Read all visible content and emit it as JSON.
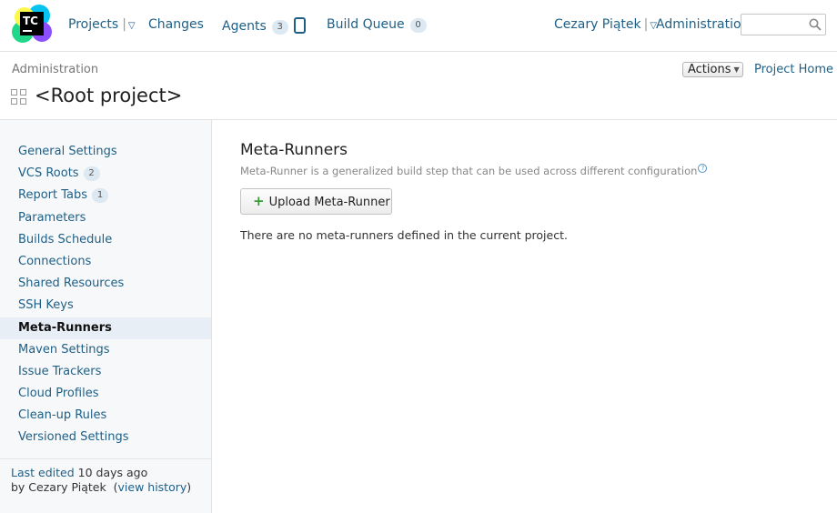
{
  "header": {
    "logo_text": "TC",
    "nav": {
      "projects": "Projects",
      "changes": "Changes",
      "agents": "Agents",
      "agents_count": "3",
      "build_queue": "Build Queue",
      "build_queue_count": "0",
      "user": "Cezary Piątek",
      "administration": "Administration"
    },
    "search": {
      "value": "",
      "placeholder": ""
    }
  },
  "page": {
    "breadcrumb": "Administration",
    "title": "<Root project>",
    "actions_label": "Actions",
    "project_home": "Project Home"
  },
  "sidebar": {
    "items": [
      {
        "label": "General Settings",
        "count": ""
      },
      {
        "label": "VCS Roots",
        "count": "2"
      },
      {
        "label": "Report Tabs",
        "count": "1"
      },
      {
        "label": "Parameters",
        "count": ""
      },
      {
        "label": "Builds Schedule",
        "count": ""
      },
      {
        "label": "Connections",
        "count": ""
      },
      {
        "label": "Shared Resources",
        "count": ""
      },
      {
        "label": "SSH Keys",
        "count": ""
      },
      {
        "label": "Meta-Runners",
        "count": ""
      },
      {
        "label": "Maven Settings",
        "count": ""
      },
      {
        "label": "Issue Trackers",
        "count": ""
      },
      {
        "label": "Cloud Profiles",
        "count": ""
      },
      {
        "label": "Clean-up Rules",
        "count": ""
      },
      {
        "label": "Versioned Settings",
        "count": ""
      }
    ],
    "active_item": "Meta-Runners",
    "last_edited_label": "Last edited",
    "last_edited_when": "10 days ago",
    "by_label": "by Cezary Piątek",
    "view_history": "view history"
  },
  "main": {
    "title": "Meta-Runners",
    "description": "Meta-Runner is a generalized build step that can be used across different configuration",
    "upload_button": "Upload Meta-Runner",
    "empty_message": "There are no meta-runners defined in the current project."
  },
  "colors": {
    "link": "#1d5f86",
    "sidebar_bg": "#f7f8fa",
    "active_item_bg": "#e8eef5",
    "badge_bg": "#dce8f2",
    "plus_green": "#3a9a3a"
  }
}
